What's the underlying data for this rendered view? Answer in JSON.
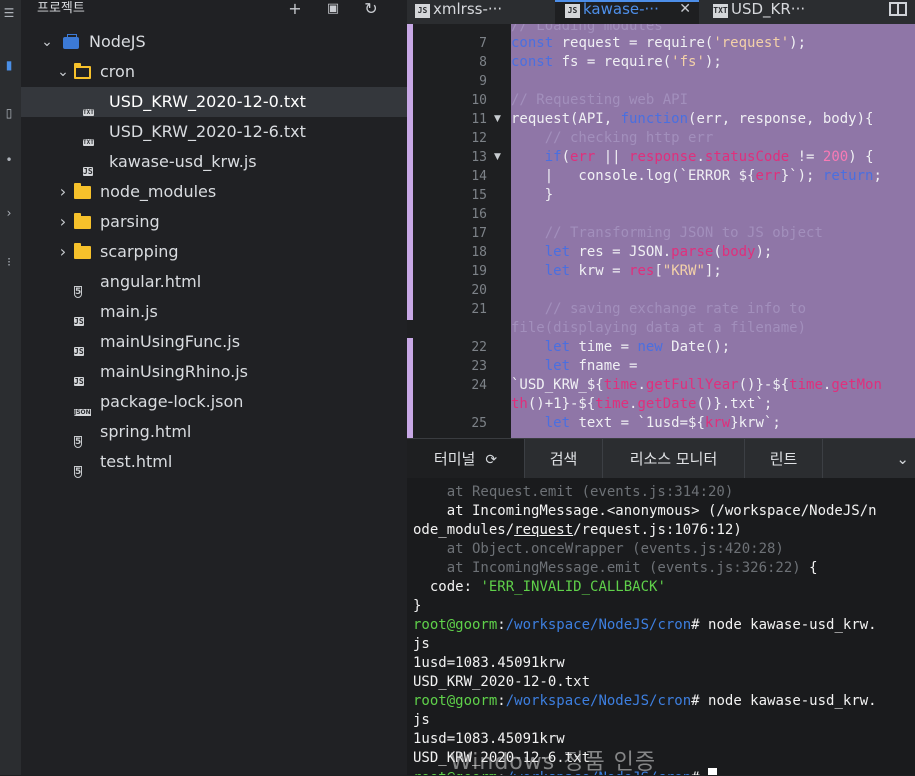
{
  "sidebar": {
    "title": "프로젝트",
    "tree": [
      {
        "label": "NodeJS",
        "icon": "project-icon",
        "expanded": true
      },
      {
        "label": "cron",
        "icon": "folder-open-icon",
        "expanded": true
      },
      {
        "label": "USD_KRW_2020-12-0.txt",
        "icon": "txt-file-icon",
        "badge": "TXT",
        "selected": true
      },
      {
        "label": "USD_KRW_2020-12-6.txt",
        "icon": "txt-file-icon",
        "badge": "TXT"
      },
      {
        "label": "kawase-usd_krw.js",
        "icon": "js-file-icon",
        "badge": "JS"
      },
      {
        "label": "node_modules",
        "icon": "folder-icon"
      },
      {
        "label": "parsing",
        "icon": "folder-icon"
      },
      {
        "label": "scarpping",
        "icon": "folder-icon"
      },
      {
        "label": "angular.html",
        "icon": "html5-file-icon",
        "badge": "5"
      },
      {
        "label": "main.js",
        "icon": "js-file-icon",
        "badge": "JS"
      },
      {
        "label": "mainUsingFunc.js",
        "icon": "js-file-icon",
        "badge": "JS"
      },
      {
        "label": "mainUsingRhino.js",
        "icon": "js-file-icon",
        "badge": "JS"
      },
      {
        "label": "package-lock.json",
        "icon": "json-file-icon",
        "badge": "JSON"
      },
      {
        "label": "spring.html",
        "icon": "html5-file-icon",
        "badge": "5"
      },
      {
        "label": "test.html",
        "icon": "html5-file-icon",
        "badge": "5"
      }
    ]
  },
  "tabs": [
    {
      "label": "xmlrss-···",
      "badge": "JS"
    },
    {
      "label": "kawase-···",
      "badge": "JS",
      "active": true,
      "close": "✕"
    },
    {
      "label": "USD_KR···",
      "badge": "TXT"
    }
  ],
  "editor": {
    "line_numbers": [
      "7",
      "8",
      "9",
      "10",
      "11",
      "12",
      "13",
      "14",
      "15",
      "16",
      "17",
      "18",
      "19",
      "20",
      "21",
      "",
      "22",
      "23",
      "24",
      "",
      "25"
    ],
    "folded_lines": [
      "11",
      "13"
    ]
  },
  "terminal_tabs": [
    "터미널",
    "검색",
    "리소스 모니터",
    "린트"
  ],
  "terminal": {
    "lines": [
      {
        "segments": [
          {
            "t": "    at Request.emit (events.js:314:20)",
            "c": "dim"
          }
        ]
      },
      {
        "segments": [
          {
            "t": "    at IncomingMessage.<anonymous> (/workspace/NodeJS/n",
            "c": ""
          }
        ]
      },
      {
        "segments": [
          {
            "t": "ode_modules/",
            "c": ""
          },
          {
            "t": "request",
            "c": "u"
          },
          {
            "t": "/request.js:1076:12)",
            "c": ""
          }
        ]
      },
      {
        "segments": [
          {
            "t": "    at Object.onceWrapper (events.js:420:28)",
            "c": "dim"
          }
        ]
      },
      {
        "segments": [
          {
            "t": "    at IncomingMessage.emit (events.js:326:22) ",
            "c": "dim"
          },
          {
            "t": "{",
            "c": ""
          }
        ]
      },
      {
        "segments": [
          {
            "t": "  code: ",
            "c": ""
          },
          {
            "t": "'ERR_INVALID_CALLBACK'",
            "c": "green"
          }
        ]
      },
      {
        "segments": [
          {
            "t": "}",
            "c": ""
          }
        ]
      },
      {
        "segments": [
          {
            "t": "root@goorm",
            "c": "green"
          },
          {
            "t": ":",
            "c": ""
          },
          {
            "t": "/workspace/NodeJS/cron",
            "c": "blue"
          },
          {
            "t": "# node kawase-usd_krw.",
            "c": ""
          }
        ]
      },
      {
        "segments": [
          {
            "t": "js",
            "c": ""
          }
        ]
      },
      {
        "segments": [
          {
            "t": "1usd=1083.45091krw",
            "c": ""
          }
        ]
      },
      {
        "segments": [
          {
            "t": "USD_KRW_2020-12-0.txt",
            "c": ""
          }
        ]
      },
      {
        "segments": [
          {
            "t": "root@goorm",
            "c": "green"
          },
          {
            "t": ":",
            "c": ""
          },
          {
            "t": "/workspace/NodeJS/cron",
            "c": "blue"
          },
          {
            "t": "# node kawase-usd_krw.",
            "c": ""
          }
        ]
      },
      {
        "segments": [
          {
            "t": "js",
            "c": ""
          }
        ]
      },
      {
        "segments": [
          {
            "t": "1usd=1083.45091krw",
            "c": ""
          }
        ]
      },
      {
        "segments": [
          {
            "t": "USD_KRW_2020-12-6.txt",
            "c": ""
          }
        ]
      },
      {
        "segments": [
          {
            "t": "root@goorm",
            "c": "green"
          },
          {
            "t": ":",
            "c": ""
          },
          {
            "t": "/workspace/NodeJS/cron",
            "c": "blue"
          },
          {
            "t": "# ",
            "c": ""
          }
        ]
      }
    ]
  },
  "watermark": "Windows 정품 인증",
  "colors": {
    "accent": "#4d8ee8",
    "selection": "#8f76a7",
    "folder": "#f6c12b"
  }
}
